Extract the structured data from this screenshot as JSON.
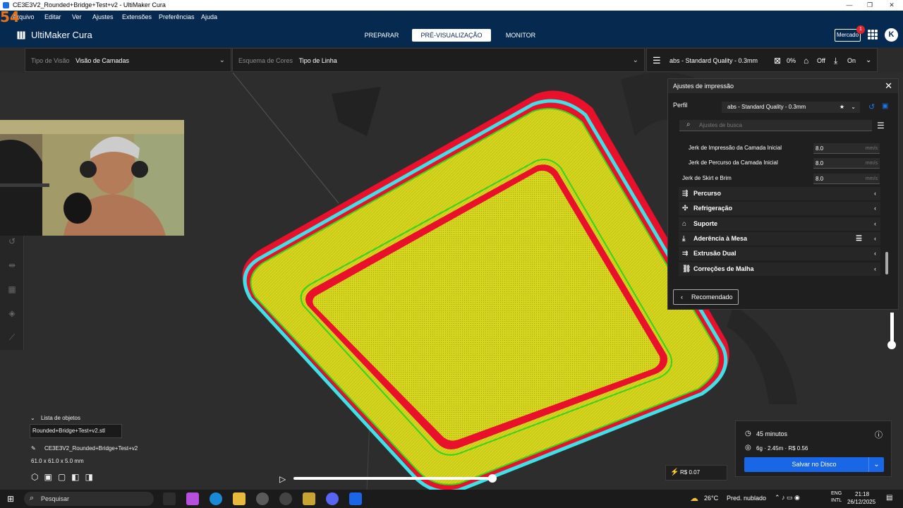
{
  "window": {
    "title": "CE3E3V2_Rounded+Bridge+Test+v2 - UltiMaker Cura",
    "stream_number": "54"
  },
  "menu": {
    "items": [
      "Arquivo",
      "Editar",
      "Ver",
      "Ajustes",
      "Extensões",
      "Preferências",
      "Ajuda"
    ]
  },
  "header": {
    "logo": "UltiMaker Cura",
    "tabs": [
      "PREPARAR",
      "PRÉ-VISUALIZAÇÃO",
      "MONITOR"
    ],
    "active_tab": "PRÉ-VISUALIZAÇÃO",
    "marketplace": "Mercado",
    "marketplace_badge": "1",
    "avatar": "K"
  },
  "viewbar": {
    "view_type_label": "Tipo de Visão",
    "view_type_value": "Visão de Camadas",
    "color_scheme_label": "Esquema de Cores",
    "color_scheme_value": "Tipo de Linha",
    "profile": "abs - Standard Quality - 0.3mm",
    "infill": "0%",
    "support": "Off",
    "adhesion": "On"
  },
  "panel": {
    "title": "Ajustes de impressão",
    "profile_label": "Perfil",
    "profile_value": "abs - Standard Quality - 0.3mm",
    "search_placeholder": "Ajustes de busca",
    "settings": [
      {
        "label": "Jerk de Impressão da Camada Inicial",
        "value": "8.0",
        "unit": "mm/s"
      },
      {
        "label": "Jerk de Percurso da Camada Inicial",
        "value": "8.0",
        "unit": "mm/s"
      },
      {
        "label": "Jerk de Skirt e Brim",
        "value": "8.0",
        "unit": "mm/s"
      }
    ],
    "categories": [
      {
        "label": "Percurso",
        "icon": "travel-icon"
      },
      {
        "label": "Refrigeração",
        "icon": "fan-icon"
      },
      {
        "label": "Suporte",
        "icon": "support-icon"
      },
      {
        "label": "Aderência à Mesa",
        "icon": "adhesion-icon"
      },
      {
        "label": "Extrusão Dual",
        "icon": "dual-extrusion-icon"
      },
      {
        "label": "Correções de Malha",
        "icon": "mesh-fix-icon"
      }
    ],
    "recommended_button": "Recomendado"
  },
  "objects": {
    "header": "Lista de objetos",
    "file": "Rounded+Bridge+Test+v2.stl",
    "model_name": "CE3E3V2_Rounded+Bridge+Test+v2",
    "dimensions": "61.0 x 61.0 x 5.0 mm"
  },
  "estimate": {
    "time": "45 minutos",
    "material": "6g · 2.45m · R$ 0.56",
    "save_button": "Salvar no Disco",
    "cost": "R$ 0.07"
  },
  "taskbar": {
    "search": "Pesquisar",
    "weather_temp": "26°C",
    "weather_text": "Pred. nublado",
    "lang1": "ENG",
    "lang2": "INTL",
    "time": "21:18",
    "date": "26/12/2025"
  },
  "colors": {
    "header_bg": "#06294f",
    "accent_blue": "#1966e6",
    "model_yellow": "#d9d91e",
    "model_red": "#e8102a",
    "model_cyan": "#3fe0e6",
    "model_green": "#37d21d"
  }
}
